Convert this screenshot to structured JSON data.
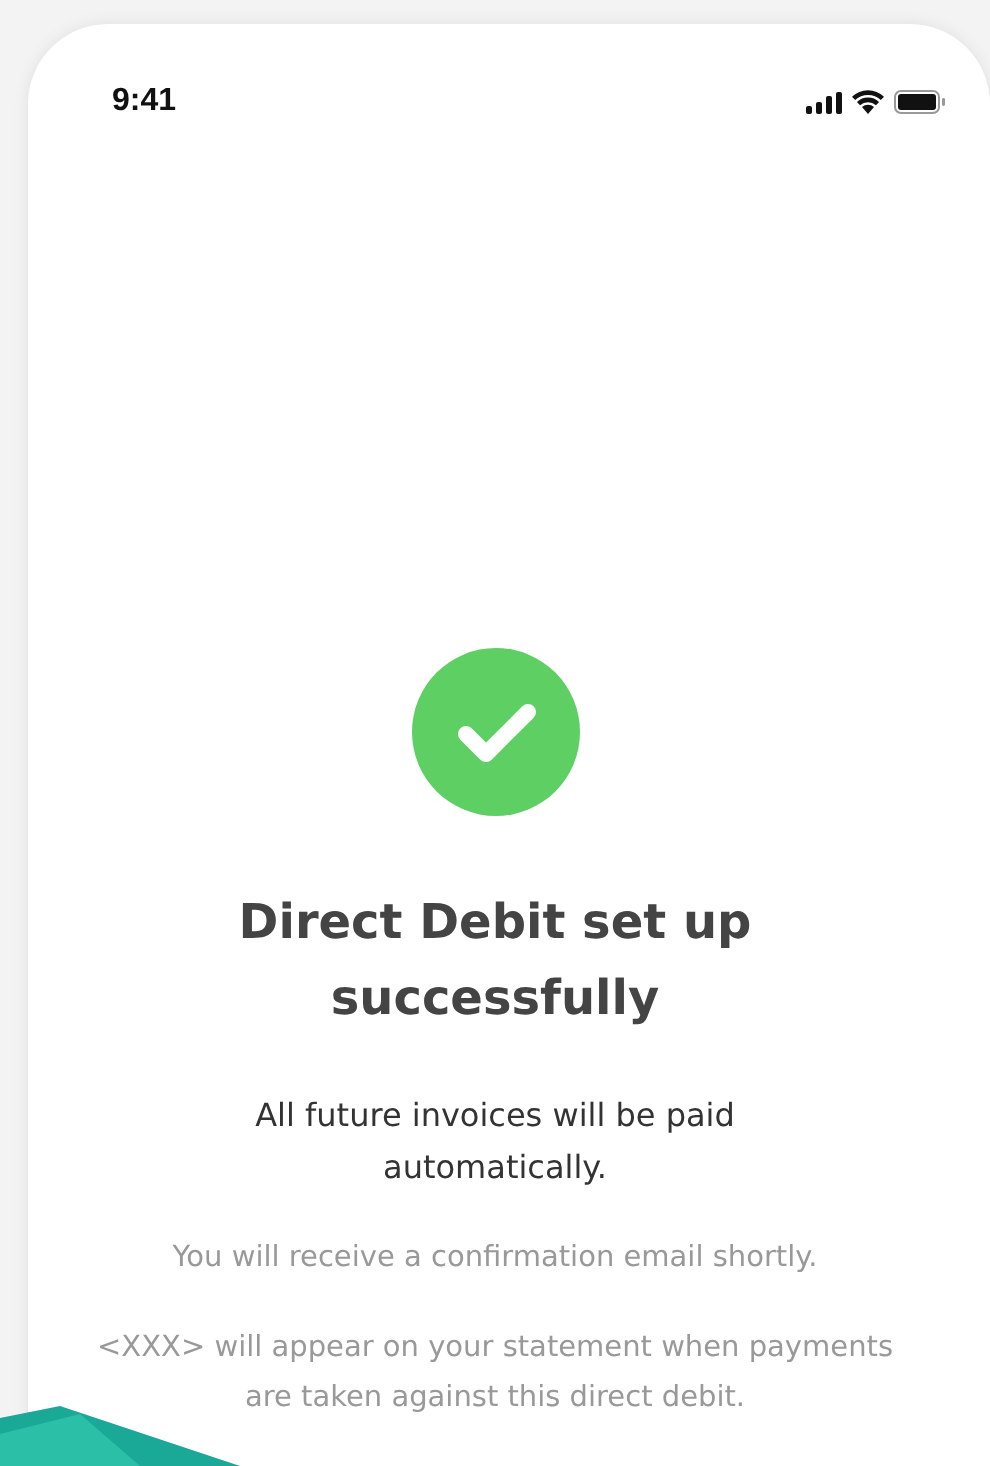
{
  "status_bar": {
    "time": "9:41"
  },
  "success": {
    "title": "Direct Debit set up successfully",
    "subtitle": "All future invoices will be paid automatically.",
    "notes": [
      "You will receive a confirmation email shortly.",
      "<XXX> will appear on your statement when payments are taken against this direct debit."
    ]
  }
}
